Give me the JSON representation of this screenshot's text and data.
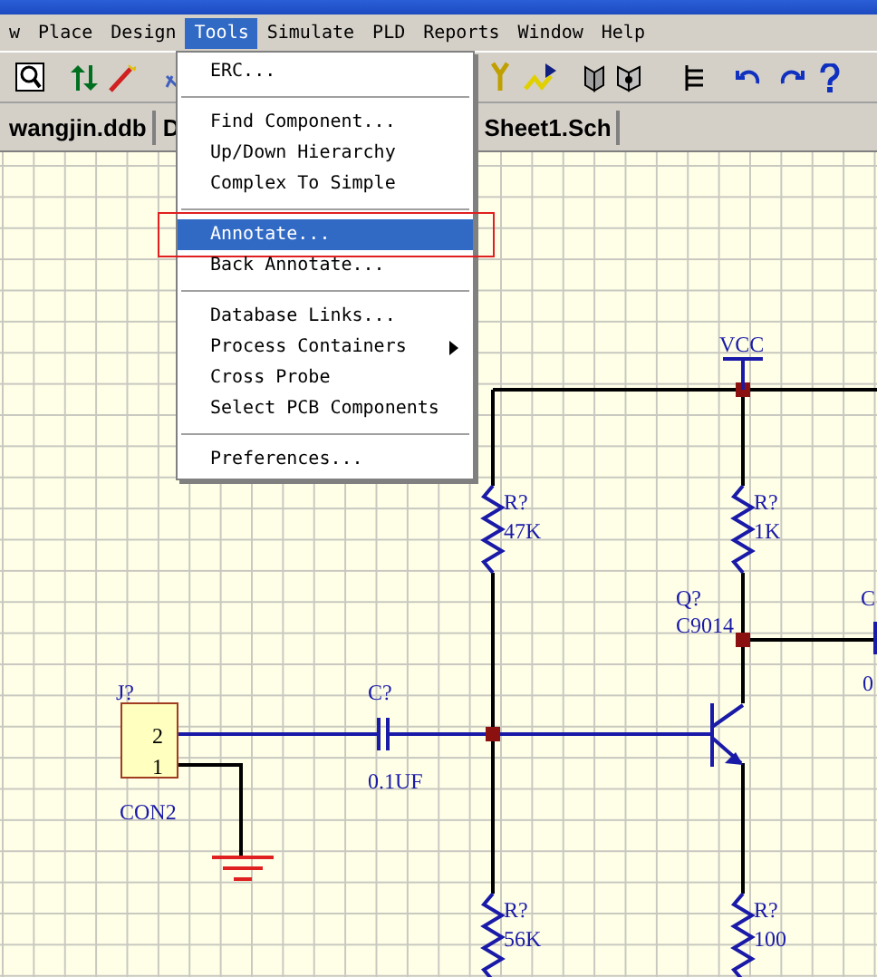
{
  "menu_bar": [
    {
      "label": "w",
      "selected": false
    },
    {
      "label": "Place",
      "selected": false
    },
    {
      "label": "Design",
      "selected": false
    },
    {
      "label": "Tools",
      "selected": true
    },
    {
      "label": "Simulate",
      "selected": false
    },
    {
      "label": "PLD",
      "selected": false
    },
    {
      "label": "Reports",
      "selected": false
    },
    {
      "label": "Window",
      "selected": false
    },
    {
      "label": "Help",
      "selected": false
    }
  ],
  "tabs": [
    {
      "label": "wangjin.ddb"
    },
    {
      "label": "D"
    },
    {
      "label": "Sheet1.Sch"
    }
  ],
  "tools_menu": {
    "items": [
      {
        "kind": "item",
        "label": "ERC...",
        "selected": false,
        "outlined": false,
        "submenu": false
      },
      {
        "kind": "separator"
      },
      {
        "kind": "item",
        "label": "Find Component...",
        "selected": false,
        "outlined": false,
        "submenu": false
      },
      {
        "kind": "item",
        "label": "Up/Down Hierarchy",
        "selected": false,
        "outlined": false,
        "submenu": false
      },
      {
        "kind": "item",
        "label": "Complex To Simple",
        "selected": false,
        "outlined": false,
        "submenu": false
      },
      {
        "kind": "separator"
      },
      {
        "kind": "item",
        "label": "Annotate...",
        "selected": true,
        "outlined": true,
        "submenu": false
      },
      {
        "kind": "item",
        "label": "Back Annotate...",
        "selected": false,
        "outlined": false,
        "submenu": false
      },
      {
        "kind": "separator"
      },
      {
        "kind": "item",
        "label": "Database Links...",
        "selected": false,
        "outlined": false,
        "submenu": false
      },
      {
        "kind": "item",
        "label": "Process Containers",
        "selected": false,
        "outlined": false,
        "submenu": true
      },
      {
        "kind": "item",
        "label": "Cross Probe",
        "selected": false,
        "outlined": false,
        "submenu": false
      },
      {
        "kind": "item",
        "label": "Select PCB Components",
        "selected": false,
        "outlined": false,
        "submenu": false
      },
      {
        "kind": "separator"
      },
      {
        "kind": "item",
        "label": "Preferences...",
        "selected": false,
        "outlined": false,
        "submenu": false
      }
    ]
  },
  "schematic": {
    "components": [
      {
        "kind": "power",
        "label": "VCC"
      },
      {
        "kind": "resistor",
        "designator": "R?",
        "value": "47K"
      },
      {
        "kind": "resistor",
        "designator": "R?",
        "value": "1K"
      },
      {
        "kind": "transistor",
        "designator": "Q?",
        "value": "C9014"
      },
      {
        "kind": "connector",
        "designator": "J?",
        "value": "CON2",
        "pins": [
          "2",
          "1"
        ]
      },
      {
        "kind": "capacitor",
        "designator": "C?",
        "value": "0.1UF"
      },
      {
        "kind": "ground"
      },
      {
        "kind": "resistor",
        "designator": "R?",
        "value": "56K"
      },
      {
        "kind": "resistor",
        "designator": "R?",
        "value": "100"
      },
      {
        "kind": "capacitor",
        "designator": "C",
        "value": "0"
      }
    ]
  }
}
